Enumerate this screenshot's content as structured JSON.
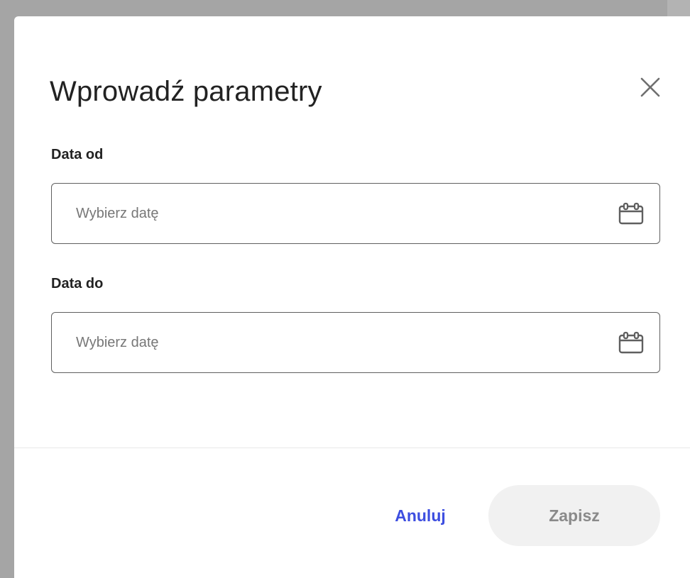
{
  "dialog": {
    "title": "Wprowadź parametry",
    "close_icon": "close-icon"
  },
  "fields": [
    {
      "label": "Data od",
      "placeholder": "Wybierz datę",
      "value": "",
      "icon": "calendar-icon"
    },
    {
      "label": "Data do",
      "placeholder": "Wybierz datę",
      "value": "",
      "icon": "calendar-icon"
    }
  ],
  "footer": {
    "cancel_label": "Anuluj",
    "save_label": "Zapisz"
  },
  "colors": {
    "backdrop": "#a5a5a5",
    "dialog_background": "#ffffff",
    "accent": "#3d4ee0",
    "disabled_button_bg": "#f1f1f1",
    "disabled_button_text": "#8a8a8a",
    "field_border": "#5f5f5f"
  }
}
